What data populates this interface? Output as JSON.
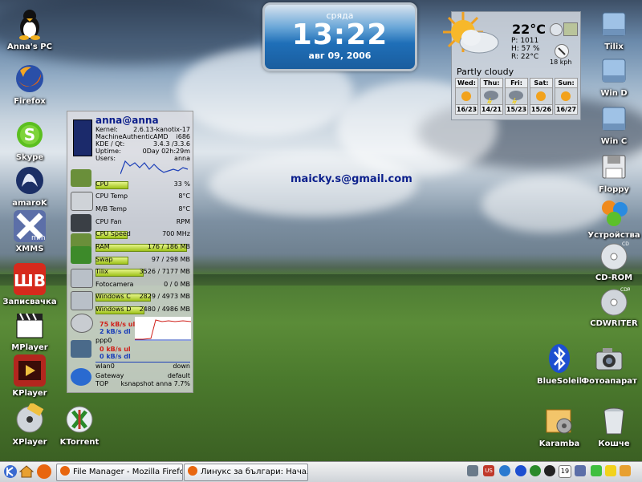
{
  "desktop": {
    "left_icons": [
      {
        "label": "Anna's PC",
        "icon": "tux-icon"
      },
      {
        "label": "Firefox",
        "icon": "firefox-icon"
      },
      {
        "label": "Skype",
        "icon": "skype-icon"
      },
      {
        "label": "amaroK",
        "icon": "amarok-icon"
      },
      {
        "label": "XMMS",
        "icon": "xmms-icon"
      },
      {
        "label": "Записвачка",
        "icon": "k3b-icon"
      },
      {
        "label": "MPlayer",
        "icon": "clapperboard-icon"
      },
      {
        "label": "KPlayer",
        "icon": "kplayer-icon"
      },
      {
        "label": "XPlayer",
        "icon": "disc-player-icon"
      },
      {
        "label": "KTorrent",
        "icon": "ktorrent-icon"
      }
    ],
    "right_icons": [
      {
        "label": "Tilix",
        "icon": "hard-drive-icon"
      },
      {
        "label": "Win D",
        "icon": "hard-drive-icon"
      },
      {
        "label": "Win C",
        "icon": "hard-drive-icon"
      },
      {
        "label": "Floppy",
        "icon": "floppy-icon"
      },
      {
        "label": "Устройства",
        "icon": "devices-icon"
      },
      {
        "label": "CD-ROM",
        "icon": "cdrom-icon"
      },
      {
        "label": "CDWRITER",
        "icon": "cdwriter-icon"
      },
      {
        "label": "BlueSoleil",
        "icon": "bluetooth-icon"
      },
      {
        "label": "Фотоапарат",
        "icon": "camera-icon"
      },
      {
        "label": "Karamba",
        "icon": "karamba-icon"
      },
      {
        "label": "Кошче",
        "icon": "trash-icon"
      }
    ],
    "email": "maicky.s@gmail.com"
  },
  "clock": {
    "day": "сряда",
    "time": "13:22",
    "date": "авг 09, 2006"
  },
  "weather": {
    "temp": "22°C",
    "pressure": "P: 1011",
    "humidity": "H: 57 %",
    "realfeel": "R: 22°C",
    "wind": "18 kph",
    "condition": "Partly cloudy",
    "days": [
      {
        "name": "Wed:",
        "range": "16/23"
      },
      {
        "name": "Thu:",
        "range": "14/21"
      },
      {
        "name": "Fri:",
        "range": "15/23"
      },
      {
        "name": "Sat:",
        "range": "15/26"
      },
      {
        "name": "Sun:",
        "range": "16/27"
      }
    ]
  },
  "sysmon": {
    "user": "anna@anna",
    "kernel_label": "Kernel:",
    "kernel": "2.6.13-kanotix-17",
    "machine_label": "Machine",
    "machine": "AuthenticAMD",
    "arch": "i686",
    "kde_label": "KDE / Qt:",
    "kde": "3.4.3 /3.3.6",
    "uptime_label": "Uptime:",
    "uptime": "0Day  02h:29m",
    "users_label": "Users:",
    "users": "anna",
    "rows": [
      {
        "name": "CPU",
        "value": "33 %",
        "fill": 0.33
      },
      {
        "name": "CPU Temp",
        "value": "8°C",
        "fill": 0
      },
      {
        "name": "M/B Temp",
        "value": "8°C",
        "fill": 0
      },
      {
        "name": "CPU Fan",
        "value": "RPM",
        "fill": 0
      },
      {
        "name": "CPU Speed",
        "value": "700 MHz",
        "fill": 0.32
      },
      {
        "name": "RAM",
        "value": "176 / 186 MB",
        "fill": 0.95
      },
      {
        "name": "Swap",
        "value": "97 / 298 MB",
        "fill": 0.33
      },
      {
        "name": "Tilix",
        "value": "3526 / 7177 MB",
        "fill": 0.49
      },
      {
        "name": "Fotocamera",
        "value": "0 / 0 MB",
        "fill": 0
      },
      {
        "name": "Windows C",
        "value": "2829 / 4973 MB",
        "fill": 0.57
      },
      {
        "name": "Windows D",
        "value": "2480 / 4986 MB",
        "fill": 0.5
      }
    ],
    "ppp_ul": "75 kB/s ul",
    "ppp_dl": "2 kB/s dl",
    "ppp_name": "ppp0",
    "wlan_ul": "0 kB/s ul",
    "wlan_dl": "0 kB/s dl",
    "wlan_name": "wlan0",
    "wlan_state": "down",
    "gateway_label": "Gateway",
    "gateway": "default",
    "top_label": "TOP",
    "top": "ksnapshot anna 7.7%"
  },
  "taskbar": {
    "tasks": [
      {
        "label": "File Manager - Mozilla Firefox"
      },
      {
        "label": "Линукс за българи: Начало - Mozilla Firefox"
      }
    ],
    "lang": "US",
    "tray_number": "19"
  }
}
